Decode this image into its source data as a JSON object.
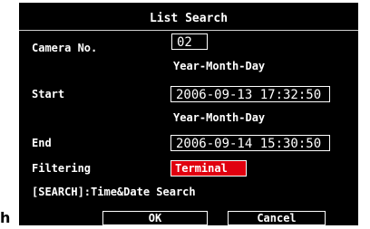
{
  "dialog": {
    "title": "List Search",
    "camera_label": "Camera No.",
    "camera_value": "02",
    "date_format_1": "Year-Month-Day",
    "start_label": "Start",
    "start_value": "2006-09-13 17:32:50",
    "date_format_2": "Year-Month-Day",
    "end_label": "End",
    "end_value": "2006-09-14 15:30:50",
    "filtering_label": "Filtering",
    "filtering_value": "Terminal",
    "hint": "[SEARCH]:Time&Date Search",
    "ok_label": "OK",
    "cancel_label": "Cancel"
  },
  "page_edge_text": "h",
  "colors": {
    "panel_bg": "#000000",
    "text": "#ffffff",
    "selected_field": "#e0000f"
  }
}
